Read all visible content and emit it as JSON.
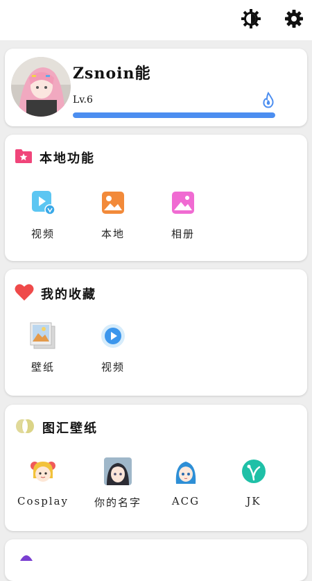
{
  "profile": {
    "username": "Zsnoin能",
    "level": "Lv.6",
    "progress_fraction": 1.0
  },
  "local": {
    "title": "本地功能",
    "items": [
      {
        "label": "视频",
        "icon": "video-file-icon"
      },
      {
        "label": "本地",
        "icon": "image-icon"
      },
      {
        "label": "相册",
        "icon": "album-icon"
      }
    ]
  },
  "favorites": {
    "title": "我的收藏",
    "items": [
      {
        "label": "壁纸",
        "icon": "wallpaper-icon"
      },
      {
        "label": "视频",
        "icon": "play-video-icon"
      }
    ]
  },
  "collection": {
    "title": "图汇壁纸",
    "items": [
      {
        "label": "Cosplay",
        "icon": "cosplay-avatar-icon"
      },
      {
        "label": "你的名字",
        "icon": "your-name-avatar-icon"
      },
      {
        "label": "ACG",
        "icon": "acg-avatar-icon"
      },
      {
        "label": "JK",
        "icon": "jk-icon"
      }
    ]
  },
  "colors": {
    "accent_blue": "#4c8ef0",
    "folder_pink": "#f0457a",
    "heart_red": "#ef4a4a",
    "jk_teal": "#1fc0a7"
  }
}
